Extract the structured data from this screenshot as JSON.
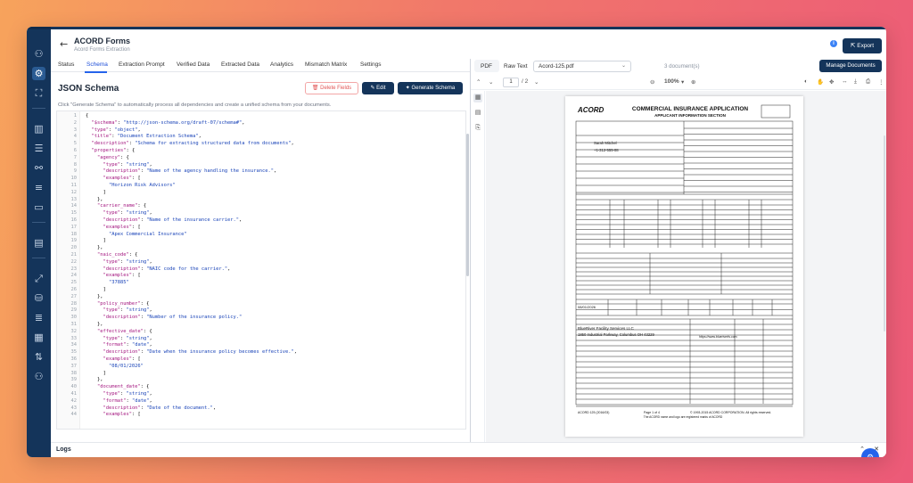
{
  "header": {
    "title": "ACORD Forms",
    "subtitle": "Acord Forms Extraction",
    "export_label": "Export"
  },
  "tabs": [
    {
      "label": "Status"
    },
    {
      "label": "Schema"
    },
    {
      "label": "Extraction Prompt"
    },
    {
      "label": "Verified Data"
    },
    {
      "label": "Extracted Data"
    },
    {
      "label": "Analytics"
    },
    {
      "label": "Mismatch Matrix"
    },
    {
      "label": "Settings"
    }
  ],
  "schema": {
    "heading": "JSON Schema",
    "delete_label": "Delete Fields",
    "edit_label": "Edit",
    "generate_label": "Generate Schema",
    "hint": "Click \"Generate Schema\" to automatically process all dependencies and create a unified schema from your documents."
  },
  "code_lines": [
    "{",
    "  \"$schema\": \"http://json-schema.org/draft-07/schema#\",",
    "  \"type\": \"object\",",
    "  \"title\": \"Document Extraction Schema\",",
    "  \"description\": \"Schema for extracting structured data from documents\",",
    "  \"properties\": {",
    "    \"agency\": {",
    "      \"type\": \"string\",",
    "      \"description\": \"Name of the agency handling the insurance.\",",
    "      \"examples\": [",
    "        \"Horizon Risk Advisors\"",
    "      ]",
    "    },",
    "    \"carrier_name\": {",
    "      \"type\": \"string\",",
    "      \"description\": \"Name of the insurance carrier.\",",
    "      \"examples\": [",
    "        \"Apex Commercial Insurance\"",
    "      ]",
    "    },",
    "    \"naic_code\": {",
    "      \"type\": \"string\",",
    "      \"description\": \"NAIC code for the carrier.\",",
    "      \"examples\": [",
    "        \"37885\"",
    "      ]",
    "    },",
    "    \"policy_number\": {",
    "      \"type\": \"string\",",
    "      \"description\": \"Number of the insurance policy.\"",
    "    },",
    "    \"effective_date\": {",
    "      \"type\": \"string\",",
    "      \"format\": \"date\",",
    "      \"description\": \"Date when the insurance policy becomes effective.\",",
    "      \"examples\": [",
    "        \"08/01/2026\"",
    "      ]",
    "    },",
    "    \"document_date\": {",
    "      \"type\": \"string\",",
    "      \"format\": \"date\",",
    "      \"description\": \"Date of the document.\",",
    "      \"examples\": ["
  ],
  "viewer": {
    "tab_pdf": "PDF",
    "tab_raw": "Raw Text",
    "file": "Acord-125.pdf",
    "doc_count": "3 document(s)",
    "manage_label": "Manage Documents",
    "page": "1",
    "page_total": "/ 2",
    "zoom": "100%"
  },
  "form": {
    "title": "COMMERCIAL INSURANCE APPLICATION",
    "section": "APPLICANT INFORMATION SECTION",
    "logo": "ACORD",
    "contact_name": "Sarah Mitchel",
    "phone": "+1-312-555-08",
    "applicant_name": "BlueRiver Facility Services LLC",
    "address": "1850 Industrial Parkway, Columbus OH 43229",
    "website": "https://www.blueriverfs.com",
    "effective": "08/01/2026",
    "footer_left": "ACORD 125 (2016/03)",
    "footer_page": "Page 1 of 4",
    "footer_copy": "© 1993-2015 ACORD CORPORATION. All rights reserved.",
    "footer_note": "The ACORD name and logo are registered marks of ACORD"
  },
  "logs": {
    "label": "Logs"
  },
  "colors": {
    "navy": "#14345a",
    "accent": "#2563eb",
    "danger": "#e25555"
  }
}
